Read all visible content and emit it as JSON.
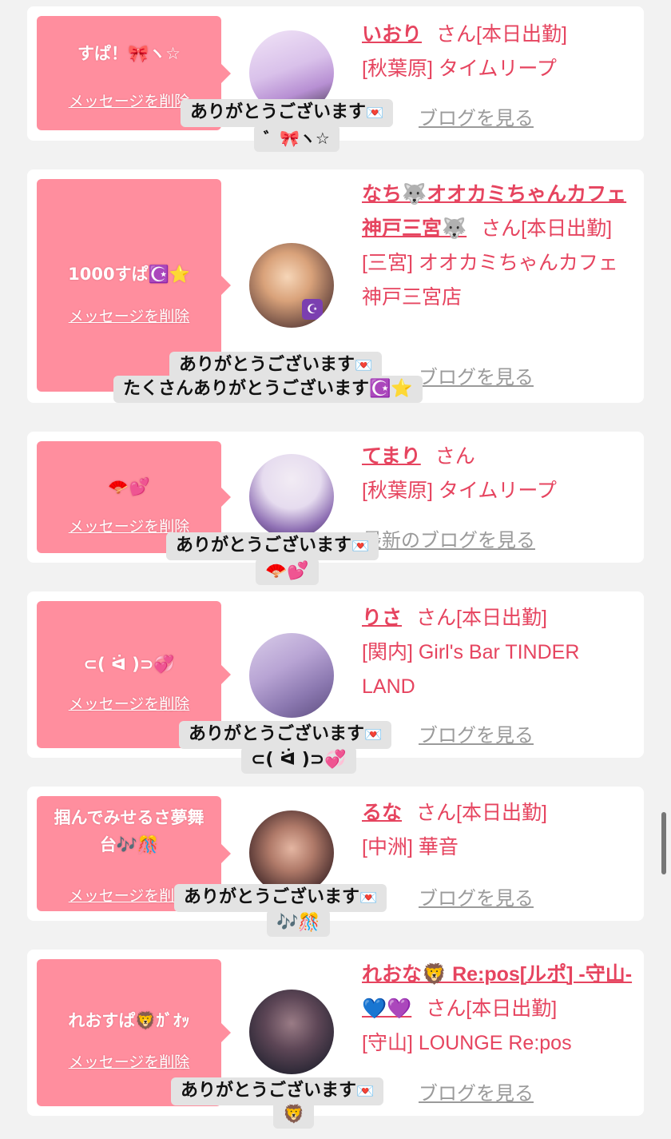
{
  "reply_line": "ありがとうございます",
  "reply_heart": "💌",
  "delete_label": "メッセージを削除",
  "san_label": "さん",
  "working_today": "[本日出勤]",
  "blog_link_label": "ブログを見る",
  "blog_link_label_full": "最新のブログを見る",
  "colors": {
    "bubble": "#ff8e9e",
    "accent": "#e6445f",
    "link_gray": "#9a9a9a"
  },
  "items": [
    {
      "message": "すぱ！🎀ヽ☆",
      "name": "いおり",
      "working": "[本日出勤]",
      "shop": "[秋葉原] タイムリープ",
      "reply_tail": "゛🎀ヽ☆"
    },
    {
      "message": "1000すぱ☪️⭐",
      "name": "なち🐺オオカミちゃんカフェ神戸三宮🐺",
      "working": "[本日出勤]",
      "shop": "[三宮] オオカミちゃんカフェ神戸三宮店",
      "reply_tail": "たくさんありがとうございます☪️⭐"
    },
    {
      "message": "🪭💕",
      "name": "てまり",
      "working": "",
      "shop": "[秋葉原] タイムリープ",
      "reply_tail": "🪭💕"
    },
    {
      "message": "⊂( ᐛ )⊃💞",
      "name": "りさ",
      "working": "[本日出勤]",
      "shop": "[関内] Girl's Bar TINDER LAND",
      "reply_tail": "⊂( ᐛ )⊃💞"
    },
    {
      "message": "掴んでみせるさ夢舞台🎶🎊",
      "name": "るな",
      "working": "[本日出勤]",
      "shop": "[中洲] 華音",
      "reply_tail": "🎶🎊"
    },
    {
      "message": "れおすぱ🦁ｶﾞｵｯ",
      "name": "れおな🦁 Re:pos[ルポ] -守山-💙💜",
      "working": "[本日出勤]",
      "shop": "[守山] LOUNGE Re:pos",
      "reply_tail": "🦁"
    }
  ]
}
